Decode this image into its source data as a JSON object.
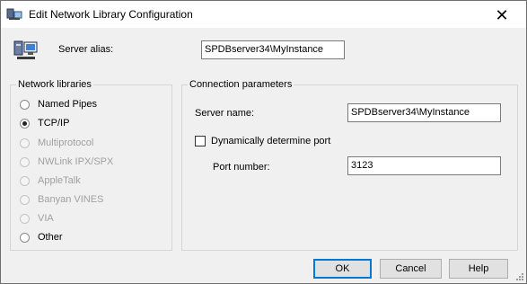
{
  "window": {
    "title": "Edit Network Library Configuration",
    "close_symbol": "✕",
    "title_icon": "network-config-icon"
  },
  "alias": {
    "label": "Server alias:",
    "value": "SPDBserver34\\MyInstance",
    "icon": "computer-network-icon"
  },
  "network_libraries": {
    "title": "Network libraries",
    "selected": "TCP/IP",
    "items": [
      {
        "label": "Named Pipes",
        "enabled": true,
        "checked": false
      },
      {
        "label": "TCP/IP",
        "enabled": true,
        "checked": true
      },
      {
        "label": "Multiprotocol",
        "enabled": false,
        "checked": false
      },
      {
        "label": "NWLink IPX/SPX",
        "enabled": false,
        "checked": false
      },
      {
        "label": "AppleTalk",
        "enabled": false,
        "checked": false
      },
      {
        "label": "Banyan VINES",
        "enabled": false,
        "checked": false
      },
      {
        "label": "VIA",
        "enabled": false,
        "checked": false
      },
      {
        "label": "Other",
        "enabled": true,
        "checked": false
      }
    ]
  },
  "connection": {
    "title": "Connection parameters",
    "server_name_label": "Server name:",
    "server_name_value": "SPDBserver34\\MyInstance",
    "dynamic_port_label": "Dynamically determine port",
    "dynamic_port_checked": false,
    "port_label": "Port number:",
    "port_value": "3123"
  },
  "buttons": {
    "ok": "OK",
    "cancel": "Cancel",
    "help": "Help"
  },
  "colors": {
    "window_bg": "#f0f0f0",
    "titlebar_bg": "#ffffff",
    "focus_border": "#0078d7",
    "disabled_text": "#a0a0a0"
  }
}
